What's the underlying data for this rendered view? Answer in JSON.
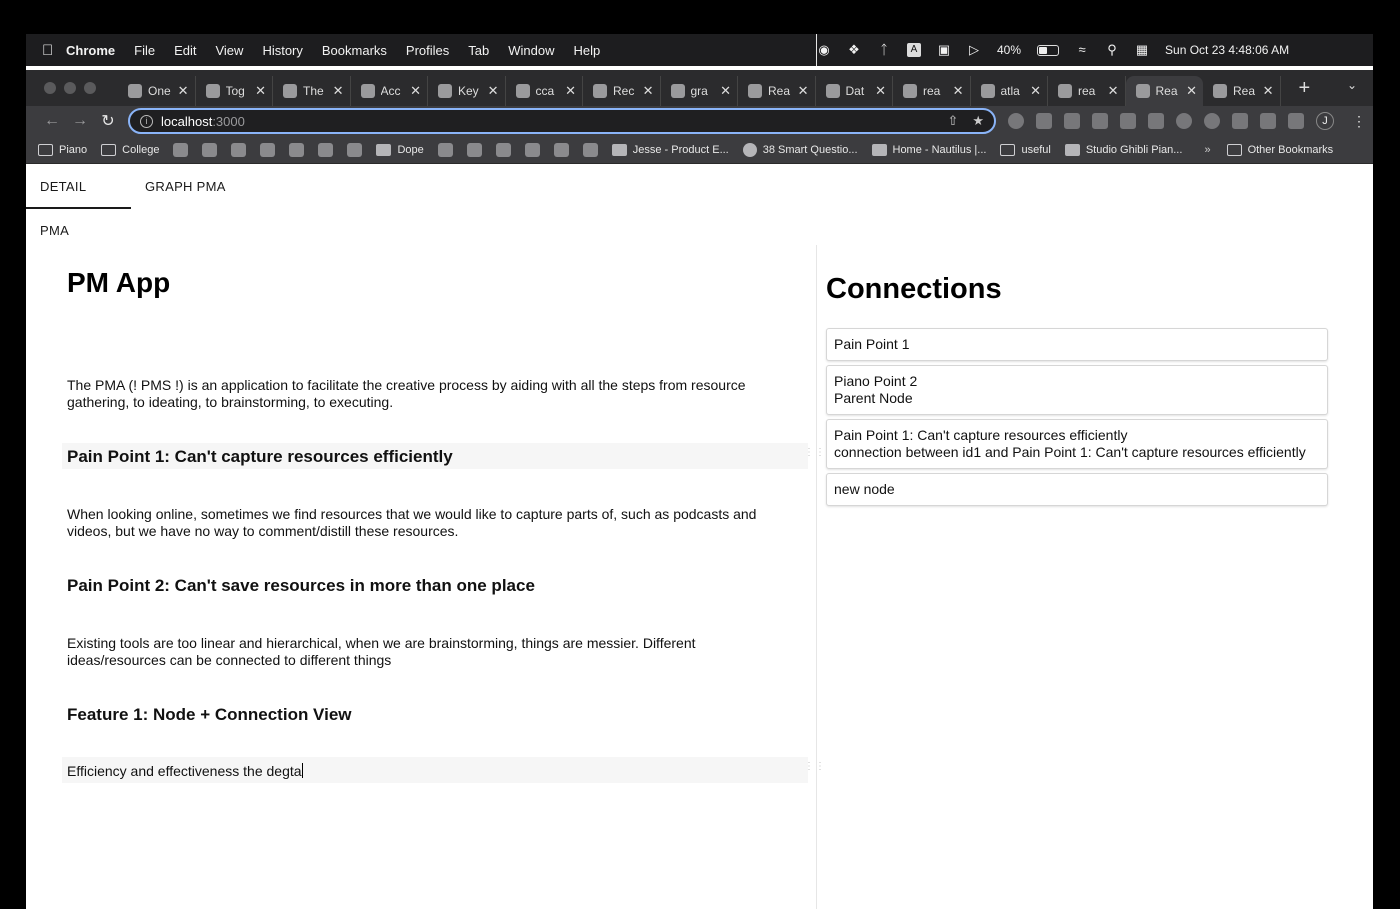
{
  "menubar": {
    "app_name": "Chrome",
    "items": [
      "File",
      "Edit",
      "View",
      "History",
      "Bookmarks",
      "Profiles",
      "Tab",
      "Window",
      "Help"
    ],
    "battery": "40%",
    "datetime": "Sun Oct 23  4:48:06 AM"
  },
  "tabs": [
    {
      "label": "One",
      "icon": "diamond-icon"
    },
    {
      "label": "Tog",
      "icon": "toggl-icon"
    },
    {
      "label": "The",
      "icon": "notion-icon"
    },
    {
      "label": "Acc",
      "icon": "settings-icon"
    },
    {
      "label": "Key",
      "icon": "settings-icon"
    },
    {
      "label": "cca",
      "icon": "github-icon"
    },
    {
      "label": "Rec",
      "icon": "figma-icon"
    },
    {
      "label": "gra",
      "icon": "firebase-icon"
    },
    {
      "label": "Rea",
      "icon": "firebase-icon"
    },
    {
      "label": "Dat",
      "icon": "rocket-icon"
    },
    {
      "label": "rea",
      "icon": "stackoverflow-icon"
    },
    {
      "label": "atla",
      "icon": "github-icon"
    },
    {
      "label": "rea",
      "icon": "github-icon"
    },
    {
      "label": "Rea",
      "icon": "react-icon",
      "active": true
    },
    {
      "label": "Rea",
      "icon": "redux-icon"
    }
  ],
  "toolbar": {
    "url_host": "localhost",
    "url_port": ":3000",
    "avatar_letter": "J"
  },
  "bookmarks": {
    "piano": "Piano",
    "college": "College",
    "dope": "Dope",
    "jesse": "Jesse - Product E...",
    "smart": "38 Smart Questio...",
    "home": "Home - Nautilus |...",
    "useful": "useful",
    "ghibli": "Studio Ghibli Pian...",
    "more": "»",
    "other": "Other Bookmarks"
  },
  "page_tabs": {
    "detail": "DETAIL PMA",
    "graph": "GRAPH PMA"
  },
  "document": {
    "title": "PM App",
    "intro": "The PMA (! PMS !) is an application to facilitate the creative process by aiding with all the steps from resource gathering, to ideating, to brainstorming, to executing.",
    "pain1_heading": "Pain Point 1: Can't capture resources efficiently",
    "pain1_body": "When looking online, sometimes we find resources that we would like to capture parts of, such as podcasts and videos, but we have no way to comment/distill these resources.",
    "pain2_heading": "Pain Point 2: Can't save resources in more than one place",
    "pain2_body": "Existing tools are too linear and hierarchical, when we are brainstorming, things are messier. Different ideas/resources can be connected to different things",
    "feature1_heading": "Feature 1: Node + Connection View",
    "feature1_body": "Efficiency and effectiveness the degta"
  },
  "connections": {
    "title": "Connections",
    "items": [
      {
        "line1": "Pain Point 1",
        "line2": null
      },
      {
        "line1": "Piano Point 2",
        "line2": "Parent Node"
      },
      {
        "line1": "Pain Point 1: Can't capture resources efficiently",
        "line2": "connection between id1  and Pain Point 1: Can't capture resources efficiently"
      },
      {
        "line1": "new node",
        "line2": null
      }
    ]
  }
}
